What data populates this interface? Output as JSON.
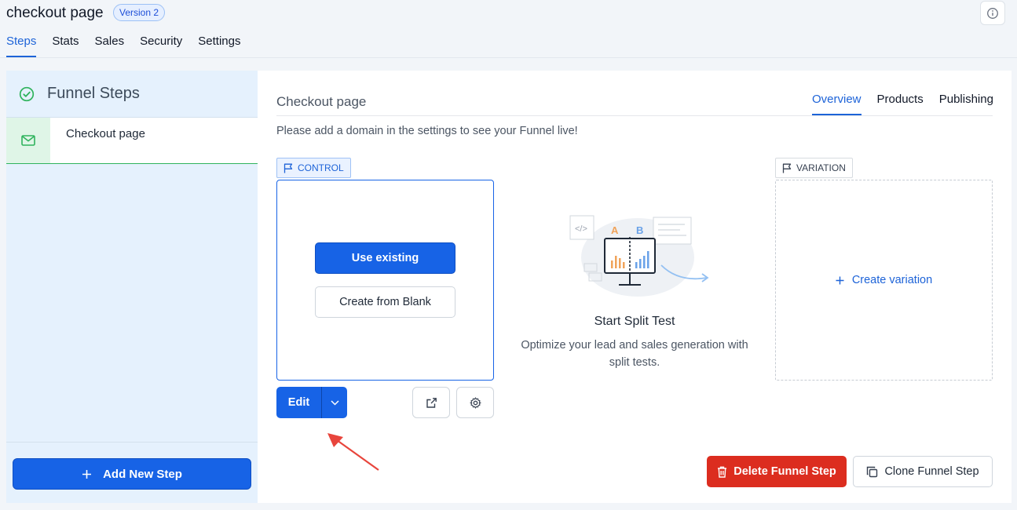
{
  "header": {
    "title": "checkout page",
    "version_badge": "Version 2",
    "info_icon": "info-icon"
  },
  "nav": {
    "tabs": [
      {
        "label": "Steps",
        "active": true
      },
      {
        "label": "Stats",
        "active": false
      },
      {
        "label": "Sales",
        "active": false
      },
      {
        "label": "Security",
        "active": false
      },
      {
        "label": "Settings",
        "active": false
      }
    ]
  },
  "sidebar": {
    "title": "Funnel Steps",
    "title_icon": "check-circle-icon",
    "steps": [
      {
        "label": "Checkout page",
        "icon": "envelope-icon"
      }
    ],
    "add_step_label": "Add New Step"
  },
  "main": {
    "title": "Checkout page",
    "tabs": [
      {
        "label": "Overview",
        "active": true
      },
      {
        "label": "Products",
        "active": false
      },
      {
        "label": "Publishing",
        "active": false
      }
    ],
    "notice": "Please add a domain in the settings to see your Funnel live!",
    "control": {
      "tag": "CONTROL",
      "use_existing_label": "Use existing",
      "create_blank_label": "Create from Blank",
      "edit_label": "Edit"
    },
    "split_test": {
      "title": "Start Split Test",
      "description": "Optimize your lead and sales generation with split tests.",
      "label_a": "A",
      "label_b": "B"
    },
    "variation": {
      "tag": "VARIATION",
      "create_label": "Create variation"
    },
    "delete_label": "Delete Funnel Step",
    "clone_label": "Clone Funnel Step"
  },
  "colors": {
    "primary": "#1763e6",
    "danger": "#dc2d1f",
    "success": "#2fb35d",
    "sidebar_bg": "#e5f1fd",
    "annotation_arrow": "#e8453c"
  }
}
